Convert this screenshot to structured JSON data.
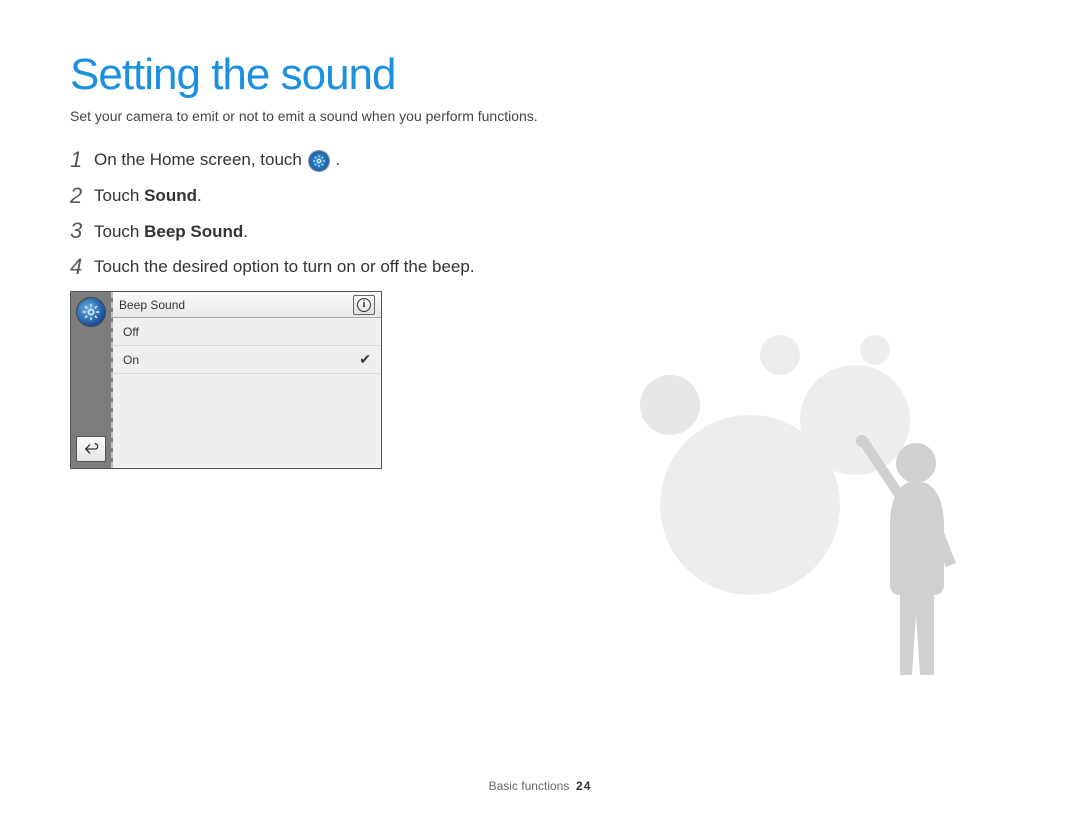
{
  "header": {
    "title": "Setting the sound",
    "subtitle": "Set your camera to emit or not to emit a sound when you perform functions."
  },
  "steps": [
    {
      "num": "1",
      "prefix": "On the Home screen, touch ",
      "icon": "settings-icon",
      "suffix": "."
    },
    {
      "num": "2",
      "prefix": "Touch ",
      "bold": "Sound",
      "suffix": "."
    },
    {
      "num": "3",
      "prefix": "Touch ",
      "bold": "Beep Sound",
      "suffix": "."
    },
    {
      "num": "4",
      "prefix": "Touch the desired option to turn on or off the beep.",
      "suffix": ""
    }
  ],
  "camera_ui": {
    "header_label": "Beep Sound",
    "options": [
      {
        "label": "Off",
        "selected": false
      },
      {
        "label": "On",
        "selected": true
      }
    ]
  },
  "footer": {
    "section": "Basic functions",
    "page": "24"
  }
}
